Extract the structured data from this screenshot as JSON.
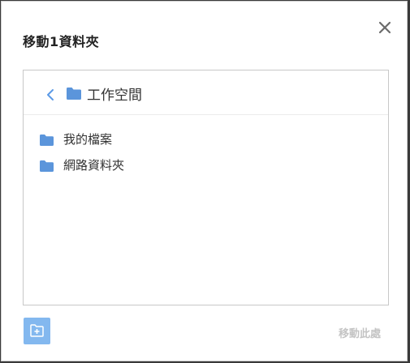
{
  "dialog": {
    "title": "移動1資料夾"
  },
  "icons": {
    "close": "close-icon",
    "back": "chevron-left-icon",
    "folder": "folder-icon",
    "new_folder": "new-folder-icon"
  },
  "colors": {
    "accent": "#5c9ae6",
    "folder": "#5b95db",
    "new_folder_button": "#83b8ef",
    "disabled_text": "#c4c4c4"
  },
  "browser": {
    "current_folder": "工作空間",
    "items": [
      {
        "label": "我的檔案"
      },
      {
        "label": "網路資料夾"
      }
    ]
  },
  "footer": {
    "move_here_label": "移動此處"
  }
}
